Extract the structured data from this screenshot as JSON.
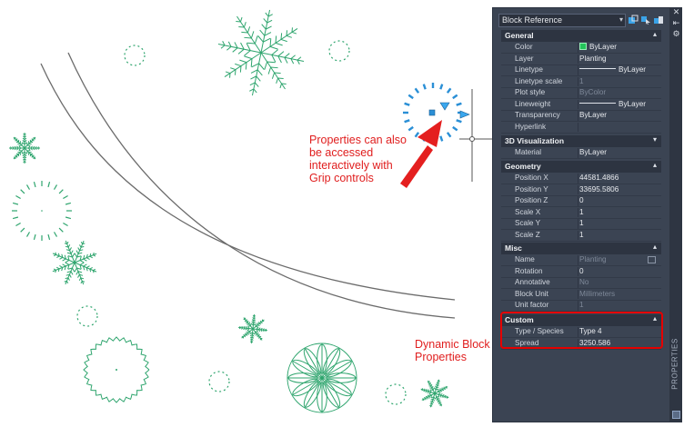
{
  "annotations": {
    "grip": "Properties can also be accessed interactively with Grip controls",
    "dynamic": "Dynamic Block Properties"
  },
  "palette": {
    "title": "PROPERTIES",
    "selector": "Block Reference",
    "sections": {
      "general": {
        "title": "General",
        "rows": [
          {
            "label": "Color",
            "value": "ByLayer"
          },
          {
            "label": "Layer",
            "value": "Planting"
          },
          {
            "label": "Linetype",
            "value": "ByLayer"
          },
          {
            "label": "Linetype scale",
            "value": "1"
          },
          {
            "label": "Plot style",
            "value": "ByColor"
          },
          {
            "label": "Lineweight",
            "value": "ByLayer"
          },
          {
            "label": "Transparency",
            "value": "ByLayer"
          },
          {
            "label": "Hyperlink",
            "value": ""
          }
        ]
      },
      "visualization": {
        "title": "3D Visualization",
        "rows": [
          {
            "label": "Material",
            "value": "ByLayer"
          }
        ]
      },
      "geometry": {
        "title": "Geometry",
        "rows": [
          {
            "label": "Position X",
            "value": "44581.4866"
          },
          {
            "label": "Position Y",
            "value": "33695.5806"
          },
          {
            "label": "Position Z",
            "value": "0"
          },
          {
            "label": "Scale X",
            "value": "1"
          },
          {
            "label": "Scale Y",
            "value": "1"
          },
          {
            "label": "Scale Z",
            "value": "1"
          }
        ]
      },
      "misc": {
        "title": "Misc",
        "rows": [
          {
            "label": "Name",
            "value": "Planting"
          },
          {
            "label": "Rotation",
            "value": "0"
          },
          {
            "label": "Annotative",
            "value": "No"
          },
          {
            "label": "Block Unit",
            "value": "Millimeters"
          },
          {
            "label": "Unit factor",
            "value": "1"
          }
        ]
      },
      "custom": {
        "title": "Custom",
        "rows": [
          {
            "label": "Type / Species",
            "value": "Type 4"
          },
          {
            "label": "Spread",
            "value": "3250.586"
          }
        ]
      }
    }
  },
  "colors": {
    "accent_annotation": "#e01e1e",
    "plant": "#2fa56e",
    "grip": "#2a8fd6",
    "palette_bg": "#3b4453"
  }
}
